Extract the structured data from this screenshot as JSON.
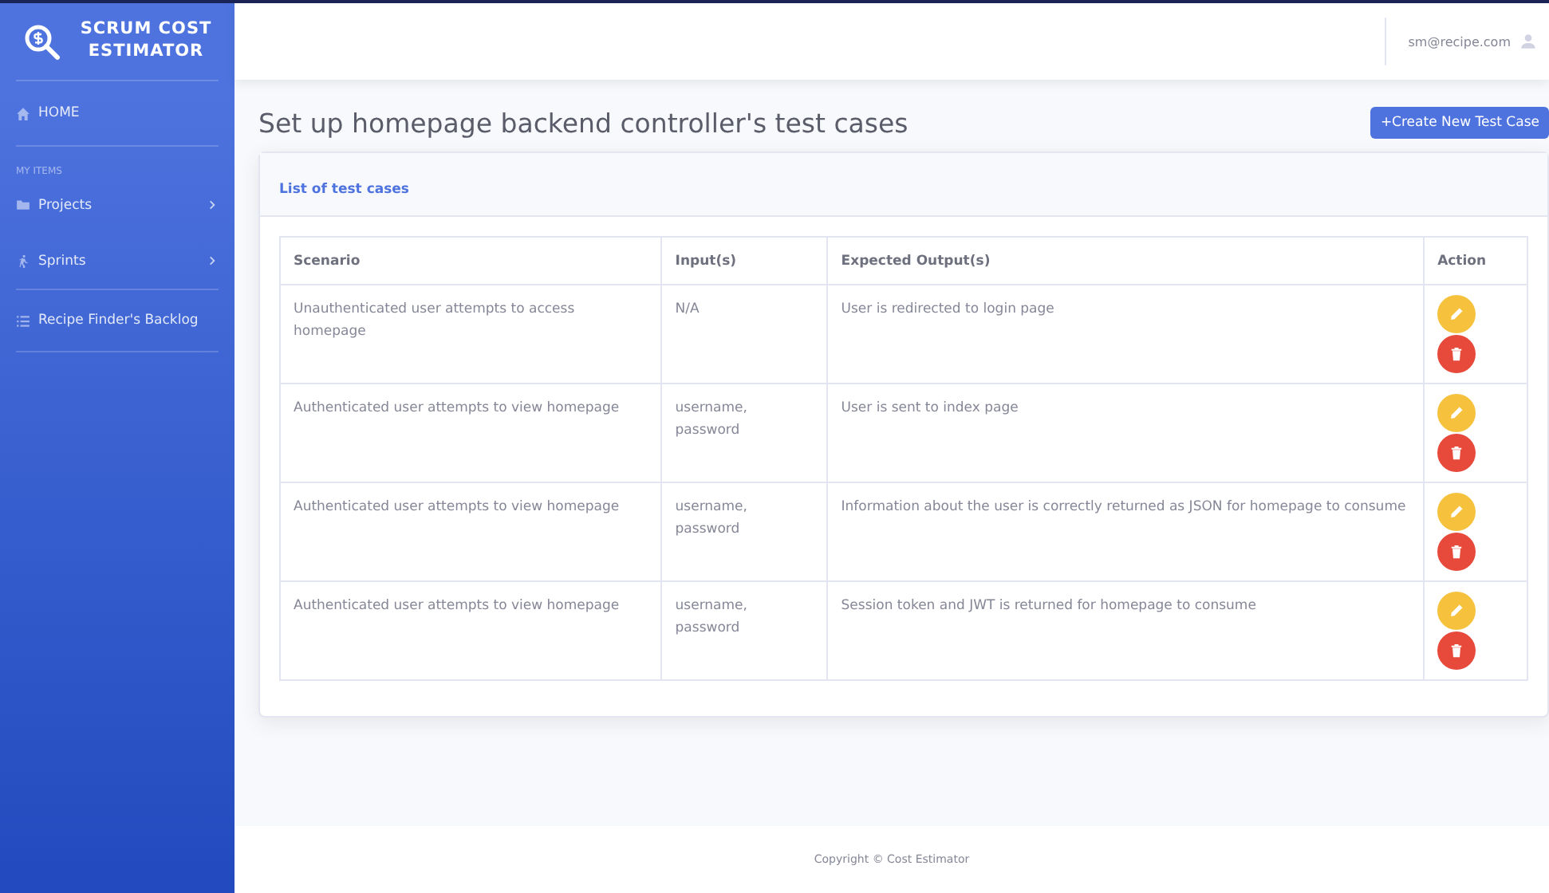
{
  "brand": {
    "title": "SCRUM COST ESTIMATOR"
  },
  "sidebar": {
    "home": "HOME",
    "section_heading": "MY ITEMS",
    "items": [
      {
        "label": "Projects",
        "kind": "menu"
      },
      {
        "label": "Sprints",
        "kind": "menu"
      }
    ],
    "backlog": "Recipe Finder's Backlog"
  },
  "topbar": {
    "user": "sm@recipe.com"
  },
  "page": {
    "title": "Set up homepage backend controller's test cases",
    "create_button": "+Create New Test Case"
  },
  "card": {
    "title": "List of test cases",
    "table": {
      "columns": [
        "Scenario",
        "Input(s)",
        "Expected Output(s)",
        "Action"
      ],
      "rows": [
        {
          "scenario": "Unauthenticated user attempts to access homepage",
          "inputs": "N/A",
          "expected": "User is redirected to login page"
        },
        {
          "scenario": "Authenticated user attempts to view homepage",
          "inputs": "username, password",
          "expected": "User is sent to index page"
        },
        {
          "scenario": "Authenticated user attempts to view homepage",
          "inputs": "username, password",
          "expected": "Information about the user is correctly returned as JSON for homepage to consume"
        },
        {
          "scenario": "Authenticated user attempts to view homepage",
          "inputs": "username, password",
          "expected": "Session token and JWT is returned for homepage to consume"
        }
      ]
    }
  },
  "footer": "Copyright © Cost Estimator"
}
